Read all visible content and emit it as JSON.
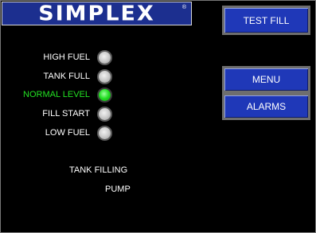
{
  "logo": {
    "text": "SIMPLEX",
    "mark": "®"
  },
  "buttons": {
    "test_fill": "TEST FILL",
    "menu": "MENU",
    "alarms": "ALARMS"
  },
  "levels": [
    {
      "label": "HIGH FUEL",
      "state": "off"
    },
    {
      "label": "TANK FULL",
      "state": "off"
    },
    {
      "label": "NORMAL LEVEL",
      "state": "on"
    },
    {
      "label": "FILL START",
      "state": "off"
    },
    {
      "label": "LOW FUEL",
      "state": "off"
    }
  ],
  "status": {
    "line1": "TANK FILLING",
    "line2": "PUMP"
  },
  "colors": {
    "button_bg": "#1f38b8",
    "logo_bg": "#1c2f8f",
    "active_text": "#22e022",
    "lamp_on": "#22dd22",
    "lamp_off": "#cfcfcf"
  }
}
